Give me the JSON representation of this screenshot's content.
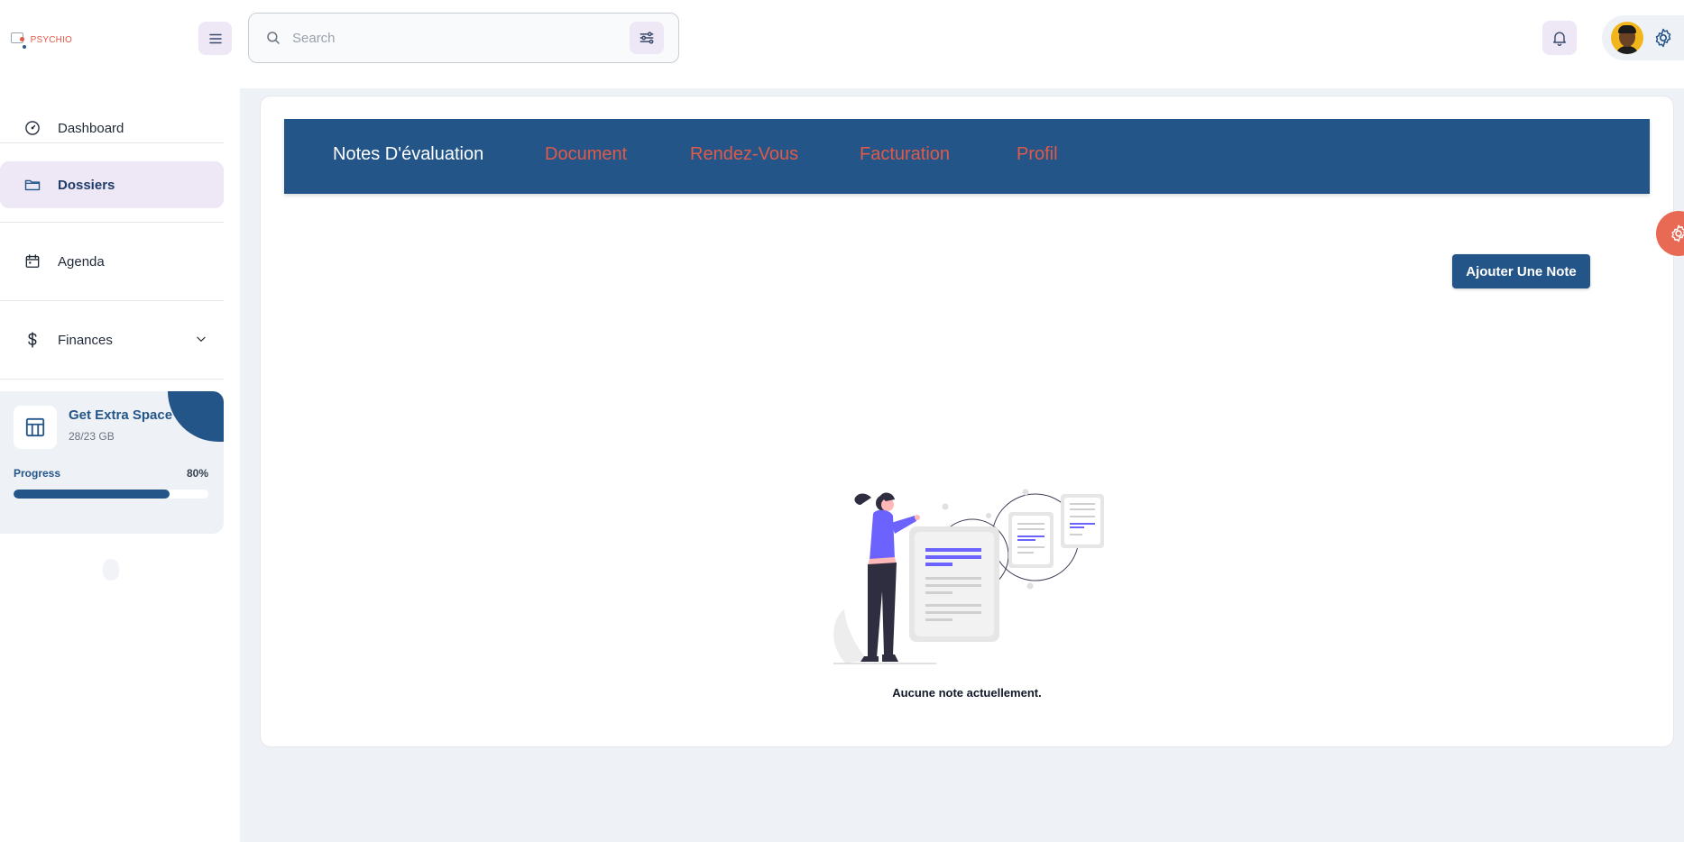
{
  "app": {
    "logo_text": "PSYCHIO"
  },
  "search": {
    "placeholder": "Search"
  },
  "sidebar": {
    "items": [
      {
        "label": "Dashboard",
        "icon": "gauge-icon",
        "active": false
      },
      {
        "label": "Dossiers",
        "icon": "folder-icon",
        "active": true
      },
      {
        "label": "Agenda",
        "icon": "calendar-icon",
        "active": false
      },
      {
        "label": "Finances",
        "icon": "dollar-icon",
        "active": false,
        "expandable": true
      }
    ],
    "storage_card": {
      "title": "Get Extra Space",
      "usage": "28/23 GB",
      "progress_label": "Progress",
      "progress_value": "80%",
      "progress_fraction": 0.8
    }
  },
  "tabs": [
    {
      "label": "Notes D'évaluation",
      "active": true
    },
    {
      "label": "Document",
      "active": false
    },
    {
      "label": "Rendez-Vous",
      "active": false
    },
    {
      "label": "Facturation",
      "active": false
    },
    {
      "label": "Profil",
      "active": false
    }
  ],
  "main": {
    "add_button_label": "Ajouter Une Note",
    "empty_message": "Aucune note actuellement."
  },
  "colors": {
    "primary": "#245589",
    "accent": "#e05a47",
    "soft_purple": "#ede7f6",
    "background": "#eef1f6"
  }
}
